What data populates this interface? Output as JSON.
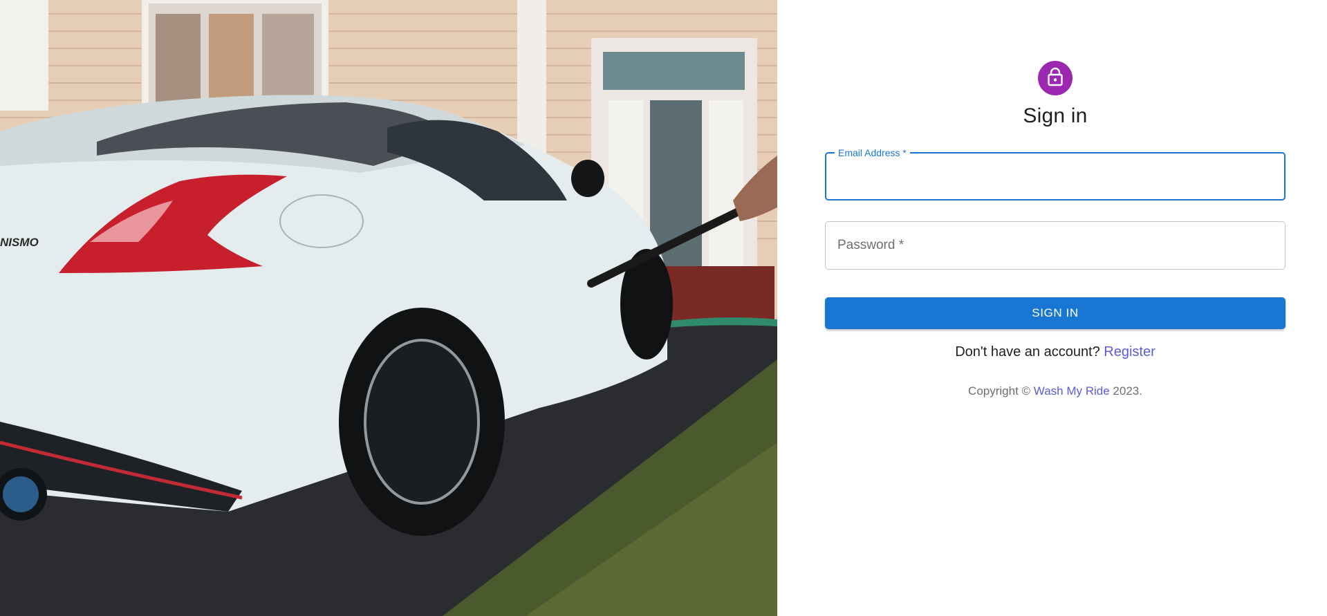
{
  "colors": {
    "avatar_bg": "#9c27b0",
    "primary": "#1976d2",
    "link": "#5b5bdc"
  },
  "hero": {
    "image_name": "car-wash-hero-image",
    "badge_text": "NISMO"
  },
  "form": {
    "icon": "lock-icon",
    "title": "Sign in",
    "email": {
      "label": "Email Address",
      "required_mark": " *",
      "value": ""
    },
    "password": {
      "label": "Password",
      "required_mark": " *",
      "value": ""
    },
    "submit_label": "Sign In",
    "register_prompt": "Don't have an account? ",
    "register_link": "Register"
  },
  "footer": {
    "copyright_prefix": "Copyright © ",
    "brand_link": "Wash My Ride",
    "copyright_suffix": " 2023."
  }
}
